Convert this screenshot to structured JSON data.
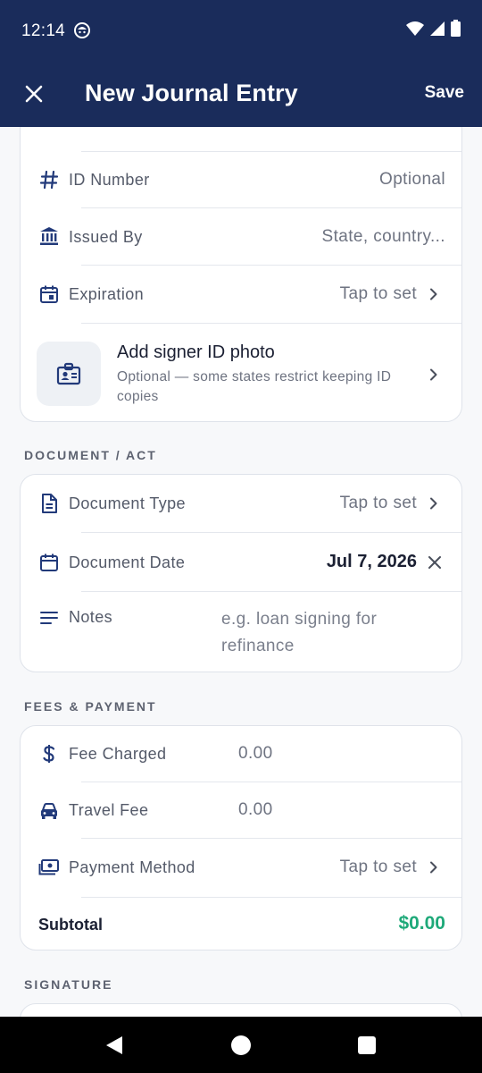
{
  "status_bar": {
    "time": "12:14"
  },
  "app_bar": {
    "title": "New Journal Entry",
    "save_label": "Save"
  },
  "id_card": {
    "rows": [
      {
        "label": "ID Number",
        "value": "Optional",
        "icon": "hash-icon"
      },
      {
        "label": "Issued By",
        "value": "State, country...",
        "icon": "bank-icon"
      },
      {
        "label": "Expiration",
        "value": "Tap to set",
        "icon": "calendar-icon"
      }
    ],
    "photo": {
      "title": "Add signer ID photo",
      "subtitle": "Optional — some states restrict keeping ID copies",
      "icon": "id-badge-icon"
    }
  },
  "document_section": {
    "header": "DOCUMENT / ACT",
    "document_type": {
      "label": "Document Type",
      "value": "Tap to set",
      "icon": "document-icon"
    },
    "document_date": {
      "label": "Document Date",
      "value": "Jul 7, 2026",
      "icon": "calendar-icon"
    },
    "notes": {
      "label": "Notes",
      "placeholder": "e.g. loan signing for refinance",
      "icon": "lines-icon"
    }
  },
  "fees_section": {
    "header": "FEES & PAYMENT",
    "fee_charged": {
      "label": "Fee Charged",
      "value": "0.00",
      "icon": "dollar-icon"
    },
    "travel_fee": {
      "label": "Travel Fee",
      "value": "0.00",
      "icon": "car-icon"
    },
    "payment_method": {
      "label": "Payment Method",
      "value": "Tap to set",
      "icon": "cash-icon"
    },
    "subtotal": {
      "label": "Subtotal",
      "value": "$0.00"
    }
  },
  "signature_section": {
    "header": "SIGNATURE"
  },
  "colors": {
    "primary": "#1a2c5b",
    "accent_green": "#1ea979",
    "icon": "#223a7a"
  }
}
